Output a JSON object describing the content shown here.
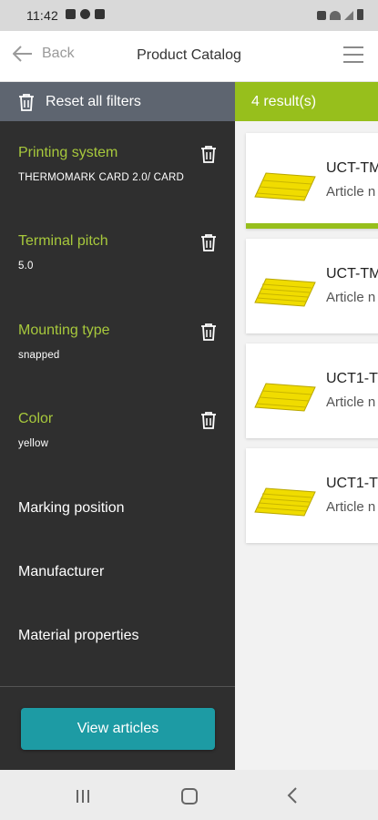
{
  "status_bar": {
    "time": "11:42"
  },
  "header": {
    "back_label": "Back",
    "title": "Product Catalog"
  },
  "sidebar": {
    "reset_label": "Reset all filters",
    "filters": [
      {
        "name": "Printing system",
        "value": "THERMOMARK CARD 2.0/ CARD"
      },
      {
        "name": "Terminal pitch",
        "value": "5.0"
      },
      {
        "name": "Mounting type",
        "value": "snapped"
      },
      {
        "name": "Color",
        "value": "yellow"
      }
    ],
    "sections": [
      "Marking position",
      "Manufacturer",
      "Material properties"
    ],
    "view_button": "View articles"
  },
  "results": {
    "count_label": "4 result(s)",
    "items": [
      {
        "title": "UCT-TM",
        "subtitle": "Article n"
      },
      {
        "title": "UCT-TM",
        "subtitle": "Article n"
      },
      {
        "title": "UCT1-T",
        "subtitle": "Article n"
      },
      {
        "title": "UCT1-T",
        "subtitle": "Article n"
      }
    ]
  },
  "colors": {
    "accent_green": "#97bf1c",
    "filter_label": "#a7c83c",
    "button_teal": "#1d9ba4",
    "sidebar_bg": "#2f2f2f"
  }
}
